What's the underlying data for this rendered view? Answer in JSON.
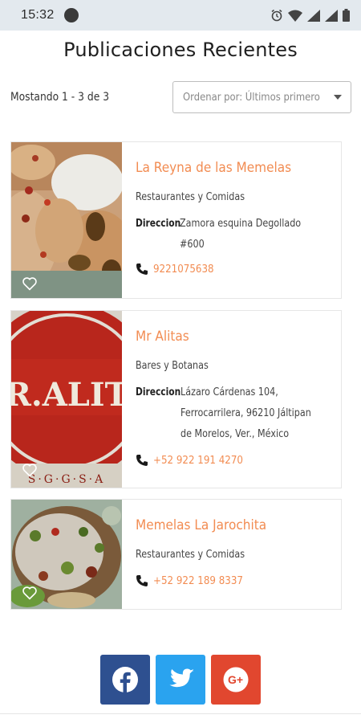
{
  "status_bar": {
    "time": "15:32"
  },
  "page": {
    "title": "Publicaciones Recientes"
  },
  "toolbar": {
    "count_text": "Mostando 1 - 3 de 3",
    "sort_value": "Ordenar por: Últimos primero"
  },
  "cards": [
    {
      "title": "La Reyna de las Memelas",
      "category": "Restaurantes y Comidas",
      "address_label": "Direccion",
      "address_lines": [
        "Zamora esquina Degollado",
        "#600"
      ],
      "phone": "9221075638"
    },
    {
      "title": "Mr Alitas",
      "category": "Bares y Botanas",
      "address_label": "Direccion",
      "address_lines": [
        "Lázaro Cárdenas 104,",
        "Ferrocarrilera, 96210 Jáltipan",
        "de Morelos, Ver., México"
      ],
      "phone": "+52 922 191 4270",
      "image_text": "R.ALIT"
    },
    {
      "title": "Memelas La Jarochita",
      "category": "Restaurantes y Comidas",
      "phone": "+52 922 189 8337"
    }
  ],
  "social": {
    "facebook": {
      "icon": "facebook-icon",
      "color": "#2e5090"
    },
    "twitter": {
      "icon": "twitter-icon",
      "color": "#2aa3ef"
    },
    "googleplus": {
      "icon": "google-plus-icon",
      "label": "G+",
      "color": "#e1472f"
    }
  },
  "colors": {
    "accent": "#f28c52",
    "status_bar": "#e3e9ee"
  }
}
